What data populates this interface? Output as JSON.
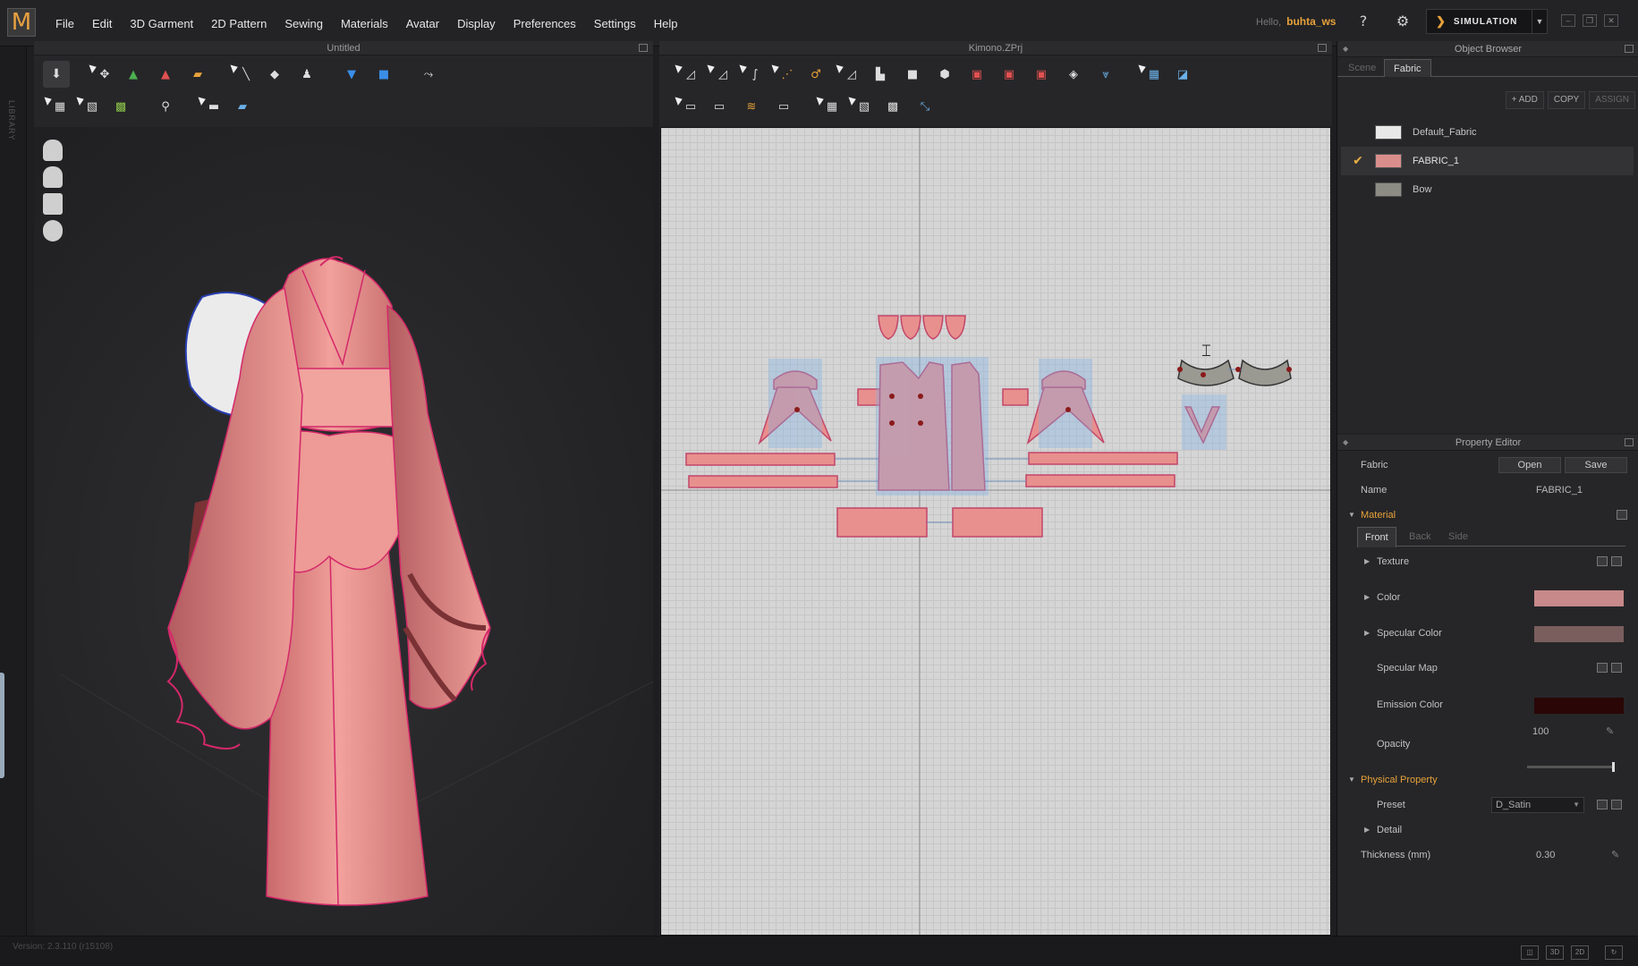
{
  "app": {
    "logo": "M",
    "menu": [
      "File",
      "Edit",
      "3D Garment",
      "2D Pattern",
      "Sewing",
      "Materials",
      "Avatar",
      "Display",
      "Preferences",
      "Settings",
      "Help"
    ],
    "hello_label": "Hello,",
    "user_name": "buhta_ws",
    "simulation_label": "SIMULATION",
    "library_label": "LIBRARY"
  },
  "panel_3d": {
    "title": "Untitled",
    "toolbar_row1": [
      "arrow-down-icon",
      "move-icon",
      "avatar-add-icon",
      "avatar-remove-icon",
      "fold-icon",
      "pin-icon",
      "brush-icon",
      "pose-icon",
      "garment-blue-icon",
      "garment-blue2-icon",
      "run-icon"
    ],
    "toolbar_row2": [
      "select-mesh-icon",
      "select-edit-icon",
      "checker-icon",
      "hanger-icon",
      "seam-select-icon",
      "flat-icon"
    ],
    "avatar_icons": [
      "head-icon",
      "body-icon",
      "pattern-icon",
      "skin-icon"
    ]
  },
  "panel_2d": {
    "title": "Kimono.ZPrj",
    "toolbar_row1": [
      "transform-pattern-icon",
      "edit-point-icon",
      "curve-point-icon",
      "add-point-icon",
      "edit-curvature-icon",
      "internal-line-icon",
      "rect-icon",
      "square-icon",
      "circle-icon",
      "dart-icon",
      "red-rect-icon",
      "red-square-icon",
      "polygon-icon",
      "fold-line-icon",
      "select-icon",
      "pattern-view-icon"
    ],
    "toolbar_row2": [
      "segment-sew-icon",
      "free-sew-icon",
      "wave-sew-icon",
      "check-sew-icon",
      "edit-texture-icon",
      "transform-texture-icon",
      "grid-icon",
      "grading-icon"
    ]
  },
  "object_browser": {
    "title": "Object Browser",
    "tabs": [
      "Scene",
      "Fabric"
    ],
    "active_tab": "Fabric",
    "actions": [
      "+ ADD",
      "COPY",
      "ASSIGN"
    ],
    "fabrics": [
      {
        "name": "Default_Fabric",
        "color": "#e8e8e8",
        "selected": false
      },
      {
        "name": "FABRIC_1",
        "color": "#d98e8c",
        "selected": true
      },
      {
        "name": "Bow",
        "color": "#8c8c84",
        "selected": false
      }
    ]
  },
  "property_editor": {
    "title": "Property Editor",
    "fabric_label": "Fabric",
    "open_label": "Open",
    "save_label": "Save",
    "name_label": "Name",
    "name_value": "FABRIC_1",
    "material_label": "Material",
    "mat_tabs": [
      "Front",
      "Back",
      "Side"
    ],
    "texture_label": "Texture",
    "color_label": "Color",
    "color_value": "#c7898a",
    "specular_color_label": "Specular Color",
    "specular_color_value": "#7a5e5e",
    "specular_map_label": "Specular Map",
    "emission_color_label": "Emission Color",
    "emission_color_value": "#2a0606",
    "opacity_label": "Opacity",
    "opacity_value": "100",
    "physical_label": "Physical Property",
    "preset_label": "Preset",
    "preset_value": "D_Satin",
    "detail_label": "Detail",
    "thickness_label": "Thickness (mm)",
    "thickness_value": "0.30"
  },
  "status": {
    "version": "Version: 2.3.110 (r15108)",
    "view_buttons": [
      "layout-icon",
      "3D",
      "2D",
      "refresh-icon"
    ]
  },
  "colors": {
    "accent": "#e8a23a",
    "fabric_pink": "#e8908e",
    "seam_magenta": "#d4286a"
  }
}
